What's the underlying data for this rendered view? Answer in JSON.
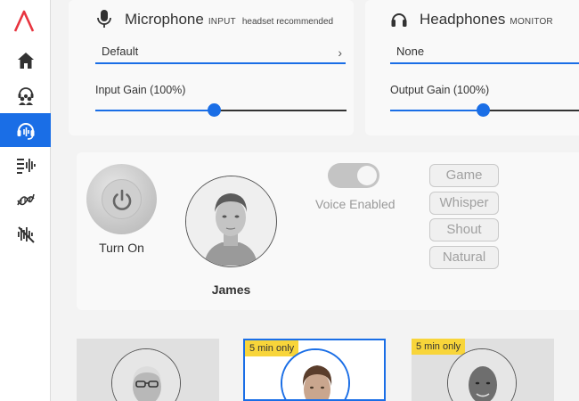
{
  "sidebar": {
    "logo": "logo-icon",
    "items": [
      {
        "name": "home",
        "icon": "home-icon",
        "active": false
      },
      {
        "name": "community",
        "icon": "users-headset-icon",
        "active": false
      },
      {
        "name": "voice-changer",
        "icon": "headset-icon",
        "active": true
      },
      {
        "name": "soundboard",
        "icon": "equalizer-icon",
        "active": false
      },
      {
        "name": "voice-lab",
        "icon": "dna-icon",
        "active": false
      },
      {
        "name": "noise-reduction",
        "icon": "waveform-cut-icon",
        "active": false
      }
    ]
  },
  "microphone": {
    "title": "Microphone",
    "tag": "INPUT",
    "note": "headset recommended",
    "device": "Default",
    "gain_label": "Input Gain (100%)",
    "gain": 0.47
  },
  "headphones": {
    "title": "Headphones",
    "tag": "MONITOR",
    "device": "None",
    "gain_label": "Output Gain (100%)",
    "gain": 0.47
  },
  "voice": {
    "power_label": "Turn On",
    "selected_name": "James",
    "toggle_label": "Voice Enabled",
    "toggle_on": true,
    "modes": [
      "Game",
      "Whisper",
      "Shout",
      "Natural"
    ]
  },
  "cards": [
    {
      "name": "older-man",
      "badge": "",
      "selected": false
    },
    {
      "name": "james",
      "badge": "5 min only",
      "selected": true
    },
    {
      "name": "bald-man",
      "badge": "5 min only",
      "selected": false
    }
  ],
  "colors": {
    "accent": "#1a6ee6",
    "badge": "#f8d53a",
    "logo": "#e8343f"
  }
}
